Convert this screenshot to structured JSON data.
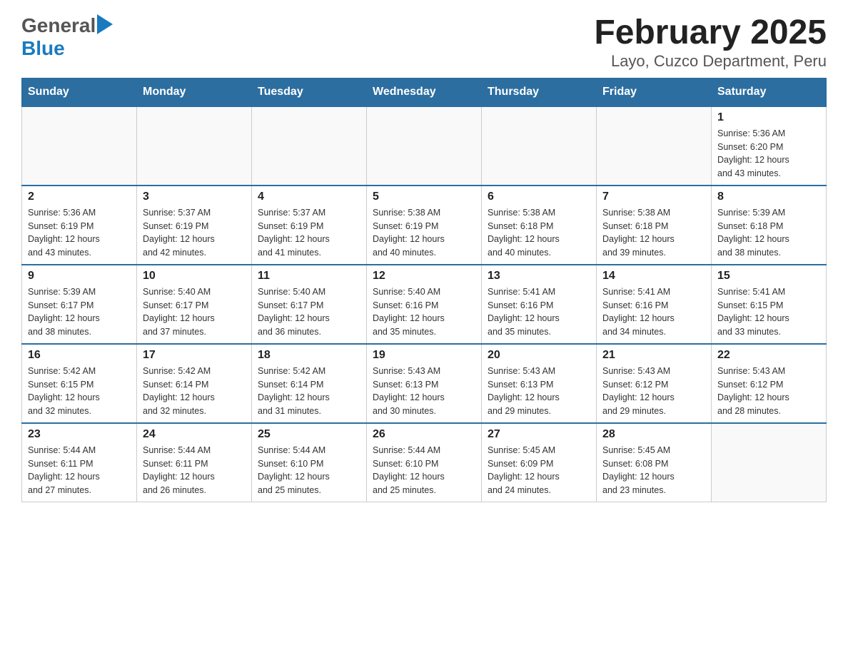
{
  "logo": {
    "general": "General",
    "blue": "Blue",
    "arrow": "▶"
  },
  "title": "February 2025",
  "subtitle": "Layo, Cuzco Department, Peru",
  "days_of_week": [
    "Sunday",
    "Monday",
    "Tuesday",
    "Wednesday",
    "Thursday",
    "Friday",
    "Saturday"
  ],
  "weeks": [
    [
      {
        "day": "",
        "info": ""
      },
      {
        "day": "",
        "info": ""
      },
      {
        "day": "",
        "info": ""
      },
      {
        "day": "",
        "info": ""
      },
      {
        "day": "",
        "info": ""
      },
      {
        "day": "",
        "info": ""
      },
      {
        "day": "1",
        "info": "Sunrise: 5:36 AM\nSunset: 6:20 PM\nDaylight: 12 hours\nand 43 minutes."
      }
    ],
    [
      {
        "day": "2",
        "info": "Sunrise: 5:36 AM\nSunset: 6:19 PM\nDaylight: 12 hours\nand 43 minutes."
      },
      {
        "day": "3",
        "info": "Sunrise: 5:37 AM\nSunset: 6:19 PM\nDaylight: 12 hours\nand 42 minutes."
      },
      {
        "day": "4",
        "info": "Sunrise: 5:37 AM\nSunset: 6:19 PM\nDaylight: 12 hours\nand 41 minutes."
      },
      {
        "day": "5",
        "info": "Sunrise: 5:38 AM\nSunset: 6:19 PM\nDaylight: 12 hours\nand 40 minutes."
      },
      {
        "day": "6",
        "info": "Sunrise: 5:38 AM\nSunset: 6:18 PM\nDaylight: 12 hours\nand 40 minutes."
      },
      {
        "day": "7",
        "info": "Sunrise: 5:38 AM\nSunset: 6:18 PM\nDaylight: 12 hours\nand 39 minutes."
      },
      {
        "day": "8",
        "info": "Sunrise: 5:39 AM\nSunset: 6:18 PM\nDaylight: 12 hours\nand 38 minutes."
      }
    ],
    [
      {
        "day": "9",
        "info": "Sunrise: 5:39 AM\nSunset: 6:17 PM\nDaylight: 12 hours\nand 38 minutes."
      },
      {
        "day": "10",
        "info": "Sunrise: 5:40 AM\nSunset: 6:17 PM\nDaylight: 12 hours\nand 37 minutes."
      },
      {
        "day": "11",
        "info": "Sunrise: 5:40 AM\nSunset: 6:17 PM\nDaylight: 12 hours\nand 36 minutes."
      },
      {
        "day": "12",
        "info": "Sunrise: 5:40 AM\nSunset: 6:16 PM\nDaylight: 12 hours\nand 35 minutes."
      },
      {
        "day": "13",
        "info": "Sunrise: 5:41 AM\nSunset: 6:16 PM\nDaylight: 12 hours\nand 35 minutes."
      },
      {
        "day": "14",
        "info": "Sunrise: 5:41 AM\nSunset: 6:16 PM\nDaylight: 12 hours\nand 34 minutes."
      },
      {
        "day": "15",
        "info": "Sunrise: 5:41 AM\nSunset: 6:15 PM\nDaylight: 12 hours\nand 33 minutes."
      }
    ],
    [
      {
        "day": "16",
        "info": "Sunrise: 5:42 AM\nSunset: 6:15 PM\nDaylight: 12 hours\nand 32 minutes."
      },
      {
        "day": "17",
        "info": "Sunrise: 5:42 AM\nSunset: 6:14 PM\nDaylight: 12 hours\nand 32 minutes."
      },
      {
        "day": "18",
        "info": "Sunrise: 5:42 AM\nSunset: 6:14 PM\nDaylight: 12 hours\nand 31 minutes."
      },
      {
        "day": "19",
        "info": "Sunrise: 5:43 AM\nSunset: 6:13 PM\nDaylight: 12 hours\nand 30 minutes."
      },
      {
        "day": "20",
        "info": "Sunrise: 5:43 AM\nSunset: 6:13 PM\nDaylight: 12 hours\nand 29 minutes."
      },
      {
        "day": "21",
        "info": "Sunrise: 5:43 AM\nSunset: 6:12 PM\nDaylight: 12 hours\nand 29 minutes."
      },
      {
        "day": "22",
        "info": "Sunrise: 5:43 AM\nSunset: 6:12 PM\nDaylight: 12 hours\nand 28 minutes."
      }
    ],
    [
      {
        "day": "23",
        "info": "Sunrise: 5:44 AM\nSunset: 6:11 PM\nDaylight: 12 hours\nand 27 minutes."
      },
      {
        "day": "24",
        "info": "Sunrise: 5:44 AM\nSunset: 6:11 PM\nDaylight: 12 hours\nand 26 minutes."
      },
      {
        "day": "25",
        "info": "Sunrise: 5:44 AM\nSunset: 6:10 PM\nDaylight: 12 hours\nand 25 minutes."
      },
      {
        "day": "26",
        "info": "Sunrise: 5:44 AM\nSunset: 6:10 PM\nDaylight: 12 hours\nand 25 minutes."
      },
      {
        "day": "27",
        "info": "Sunrise: 5:45 AM\nSunset: 6:09 PM\nDaylight: 12 hours\nand 24 minutes."
      },
      {
        "day": "28",
        "info": "Sunrise: 5:45 AM\nSunset: 6:08 PM\nDaylight: 12 hours\nand 23 minutes."
      },
      {
        "day": "",
        "info": ""
      }
    ]
  ]
}
